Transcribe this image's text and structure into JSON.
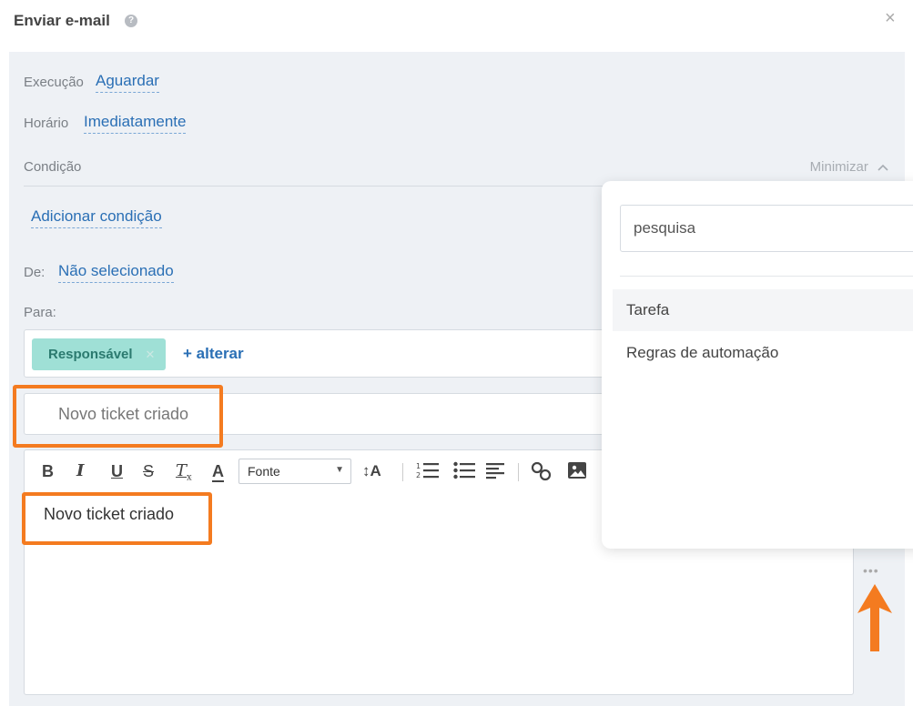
{
  "dialog": {
    "title": "Enviar e-mail",
    "help_icon": "question-circle-icon",
    "close_icon": "close-icon"
  },
  "form": {
    "execucao": {
      "label": "Execução",
      "value": "Aguardar"
    },
    "horario": {
      "label": "Horário",
      "value": "Imediatamente"
    },
    "condicao": {
      "label": "Condição",
      "minimize_label": "Minimizar",
      "minimize_icon": "chevron-up-icon",
      "add_label": "Adicionar condição"
    },
    "de": {
      "label": "De:",
      "value": "Não selecionado"
    },
    "para": {
      "label": "Para:",
      "chips": [
        {
          "label": "Responsável"
        }
      ],
      "alterar_label": "+ alterar"
    },
    "subject": "Novo ticket criado"
  },
  "editor": {
    "toolbar": {
      "bold": "B",
      "italic": "I",
      "underline": "U",
      "strike": "S",
      "clear_format": "T",
      "font_color": "A",
      "font_select": "Fonte",
      "font_size": "↕A"
    },
    "body": "Novo ticket criado",
    "more_icon": "more-dots-icon"
  },
  "dropdown": {
    "search_placeholder": "pesquisa",
    "items": [
      {
        "label": "Tarefa",
        "active": true
      },
      {
        "label": "Regras de automação",
        "active": false
      }
    ]
  },
  "colors": {
    "accent": "#2a6fb5",
    "highlight": "#f47b20",
    "chip_bg": "#9fe0d6",
    "panel_bg": "#eef1f5"
  }
}
